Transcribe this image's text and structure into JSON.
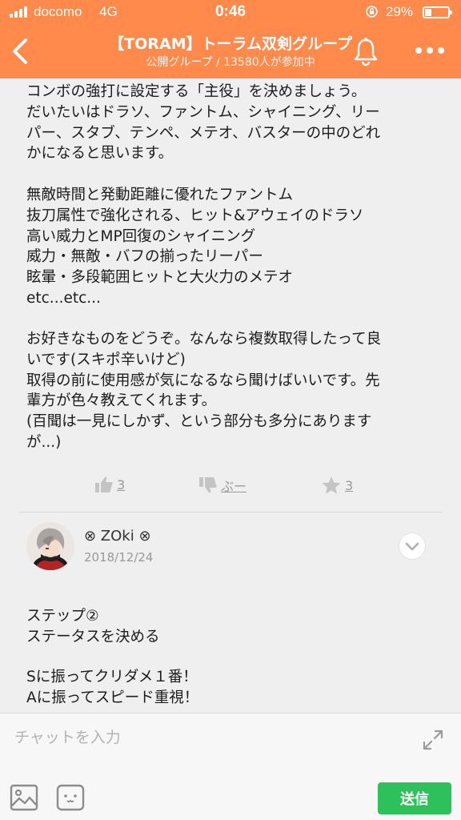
{
  "status_bar": {
    "carrier": "docomo",
    "network": "4G",
    "time": "0:46",
    "battery_percent": "29%",
    "battery_level": 0.29
  },
  "header": {
    "title": "【TORAM】トーラム双剣グループ",
    "subtitle": "公開グループ / 13580人が参加中"
  },
  "post": {
    "paragraphs": [
      [
        "コンボの強打に設定する「主役」を決めましょう。",
        "だいたいはドラソ、ファントム、シャイニング、リー",
        "パー、スタブ、テンペ、メテオ、バスターの中のどれ",
        "かになると思います。"
      ],
      [
        "無敵時間と発動距離に優れたファントム",
        "抜刀属性で強化される、ヒット&アウェイのドラソ",
        "高い威力とMP回復のシャイニング",
        "威力・無敵・バフの揃ったリーパー",
        "眩暈・多段範囲ヒットと大火力のメテオ",
        "etc...etc..."
      ],
      [
        "お好きなものをどうぞ。なんなら複数取得したって良",
        "いです(スキポ辛いけど)",
        "取得の前に使用感が気になるなら聞けばいいです。先",
        "輩方が色々教えてくれます。",
        "(百聞は一見にしかず、という部分も多分にあります",
        "が...)"
      ]
    ],
    "reactions": {
      "like_count": "3",
      "dislike_label": "ぶー",
      "favorite_count": "3"
    }
  },
  "reply": {
    "username": "⊗ ZOki ⊗",
    "date": "2018/12/24",
    "paragraphs": [
      [
        "ステップ②",
        "ステータスを決める"
      ],
      [
        "Sに振ってクリダメ１番！",
        "Aに振ってスピード重視！"
      ]
    ]
  },
  "input_bar": {
    "placeholder": "チャットを入力",
    "send_label": "送信"
  },
  "colors": {
    "header_bg": "#ff8a4c",
    "send_button": "#2ec05a",
    "page_bg": "#efefef"
  }
}
